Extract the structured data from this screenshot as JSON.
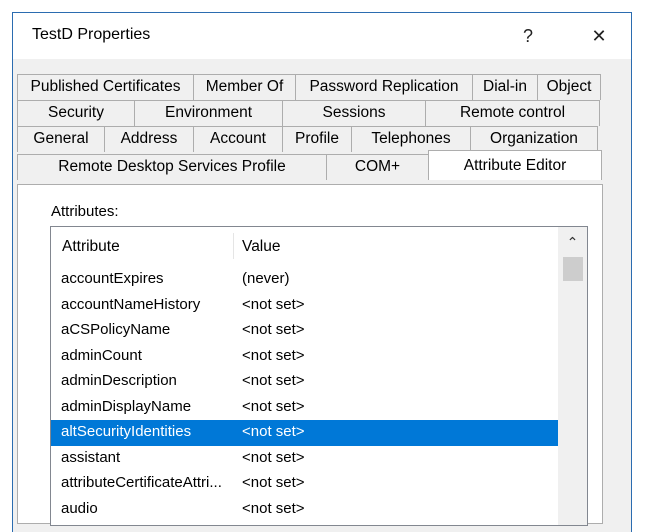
{
  "window": {
    "title": "TestD Properties",
    "help_glyph": "?",
    "close_glyph": "✕"
  },
  "tabs": {
    "row1": [
      "Published Certificates",
      "Member Of",
      "Password Replication",
      "Dial-in",
      "Object"
    ],
    "row2": [
      "Security",
      "Environment",
      "Sessions",
      "Remote control"
    ],
    "row3": [
      "General",
      "Address",
      "Account",
      "Profile",
      "Telephones",
      "Organization"
    ],
    "row4": [
      "Remote Desktop Services Profile",
      "COM+",
      "Attribute Editor"
    ],
    "active": "Attribute Editor"
  },
  "attributes_label": "Attributes:",
  "list": {
    "headers": {
      "attribute": "Attribute",
      "value": "Value"
    },
    "rows": [
      {
        "attribute": "accountExpires",
        "value": "(never)"
      },
      {
        "attribute": "accountNameHistory",
        "value": "<not set>"
      },
      {
        "attribute": "aCSPolicyName",
        "value": "<not set>"
      },
      {
        "attribute": "adminCount",
        "value": "<not set>"
      },
      {
        "attribute": "adminDescription",
        "value": "<not set>"
      },
      {
        "attribute": "adminDisplayName",
        "value": "<not set>"
      },
      {
        "attribute": "altSecurityIdentities",
        "value": "<not set>",
        "selected": true
      },
      {
        "attribute": "assistant",
        "value": "<not set>"
      },
      {
        "attribute": "attributeCertificateAttri...",
        "value": "<not set>"
      },
      {
        "attribute": "audio",
        "value": "<not set>"
      }
    ],
    "scroll_up_glyph": "⌃"
  },
  "colors": {
    "selection": "#0078d7",
    "window_border": "#2b6cb0"
  }
}
